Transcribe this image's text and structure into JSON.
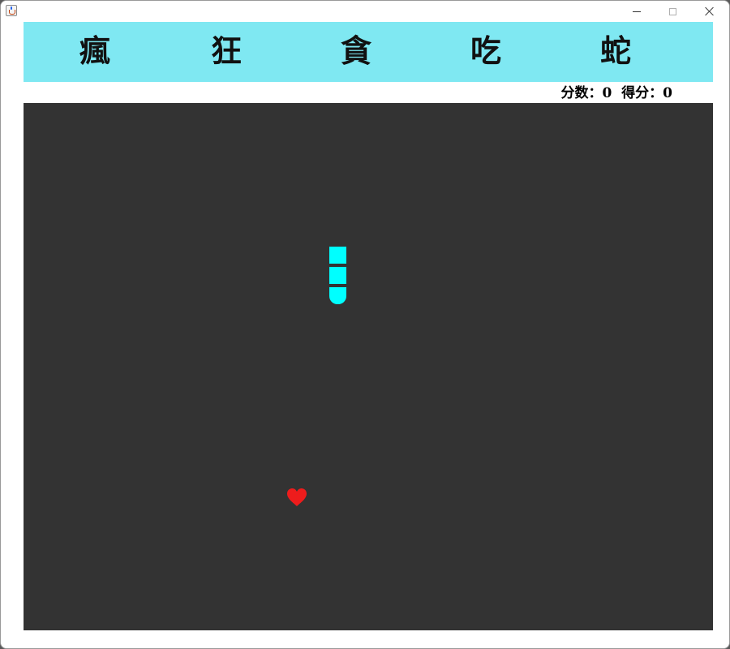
{
  "window": {
    "title": "",
    "app_icon": "java-cup-icon"
  },
  "banner": {
    "background": "#7fe8f2",
    "chars": [
      "瘋",
      "狂",
      "貪",
      "吃",
      "蛇"
    ]
  },
  "status": {
    "text": "分数：0  得分：0",
    "score_label": "分数",
    "score": 0,
    "points_label": "得分",
    "points": 0
  },
  "board": {
    "background": "#333333",
    "snake_color": "#00ffff",
    "snake_direction": "down",
    "snake_length": 3,
    "food_icon": "heart-icon",
    "food_color": "#ee1c1c"
  }
}
